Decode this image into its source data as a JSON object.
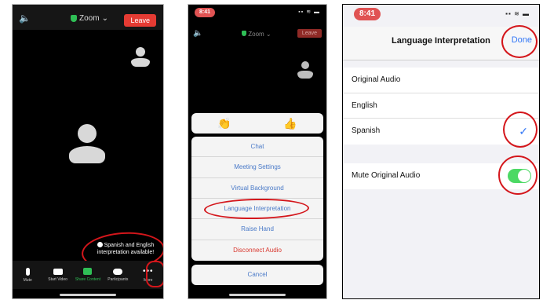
{
  "panel1": {
    "top_bar": {
      "title": "Zoom",
      "leave_label": "Leave"
    },
    "notice": {
      "text": "Spanish and English interpretation available!"
    },
    "toolbar": [
      {
        "label": "Mute",
        "icon": "microphone-icon"
      },
      {
        "label": "Start Video",
        "icon": "video-off-icon"
      },
      {
        "label": "Share Content",
        "icon": "share-content-icon",
        "accent": "#2fbf56"
      },
      {
        "label": "Participants",
        "icon": "participants-icon"
      },
      {
        "label": "More",
        "icon": "more-icon"
      }
    ]
  },
  "panel2": {
    "status_time": "8:41",
    "top_bar": {
      "title": "Zoom",
      "leave_label": "Leave"
    },
    "reactions": [
      "👏",
      "👍"
    ],
    "menu": [
      {
        "label": "Chat"
      },
      {
        "label": "Meeting Settings"
      },
      {
        "label": "Virtual Background"
      },
      {
        "label": "Language Interpretation"
      },
      {
        "label": "Raise Hand"
      },
      {
        "label": "Disconnect Audio",
        "color": "#d9382f"
      }
    ],
    "cancel_label": "Cancel"
  },
  "panel3": {
    "status_time": "8:41",
    "nav": {
      "title": "Language Interpretation",
      "done_label": "Done"
    },
    "languages": [
      {
        "label": "Original Audio",
        "selected": false
      },
      {
        "label": "English",
        "selected": false
      },
      {
        "label": "Spanish",
        "selected": true
      }
    ],
    "mute_original": {
      "label": "Mute Original Audio",
      "on": true
    }
  },
  "colors": {
    "accent_blue": "#3478f6",
    "leave_red": "#e53b33",
    "toggle_green": "#4cd964",
    "annotation_red": "#d4161b"
  }
}
